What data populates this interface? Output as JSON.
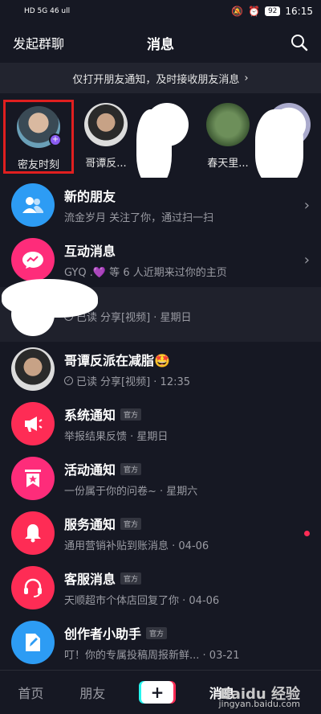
{
  "status_bar": {
    "left_text": "HD 5G 46 ull",
    "battery": "92",
    "time": "16:15"
  },
  "header": {
    "left_action": "发起群聊",
    "title": "消息"
  },
  "notice": {
    "text": "仅打开朋友通知，及时接收朋友消息",
    "arrow": "›"
  },
  "stories": [
    {
      "label": "密友时刻"
    },
    {
      "label": "哥谭反..."
    },
    {
      "label": ""
    },
    {
      "label": "春天里..."
    },
    {
      "label": ""
    }
  ],
  "messages": [
    {
      "name": "新的朋友",
      "sub": "流金岁月 关注了你，通过扫一扫",
      "chevron": "›"
    },
    {
      "name": "互动消息",
      "sub": "GYQ .💜 等 6 人近期来过你的主页",
      "chevron": "›"
    },
    {
      "name": "",
      "status": "已读",
      "sub": "分享[视频] · 星期日"
    },
    {
      "name": "哥谭反派在减脂🤩",
      "status": "已读",
      "sub": "分享[视频] · 12:35"
    },
    {
      "name": "系统通知",
      "badge": "官方",
      "sub": "举报结果反馈 · 星期日"
    },
    {
      "name": "活动通知",
      "badge": "官方",
      "sub": "一份属于你的问卷~ · 星期六"
    },
    {
      "name": "服务通知",
      "badge": "官方",
      "sub": "通用营销补贴到账消息 · 04-06"
    },
    {
      "name": "客服消息",
      "badge": "官方",
      "sub": "天顺超市个体店回复了你 · 04-06"
    },
    {
      "name": "创作者小助手",
      "badge": "官方",
      "sub": "叮！你的专属投稿周报新鲜... · 03-21"
    }
  ],
  "bottom_nav": {
    "home": "首页",
    "friends": "朋友",
    "add": "+",
    "messages": "消息",
    "watermark_line1": "Baidu 经验",
    "watermark_line2": "jingyan.baidu.com"
  },
  "colors": {
    "background": "#161823",
    "accent_red": "#fe2c55",
    "blue": "#2d9cf4",
    "pink": "#fe2c7a",
    "official_badge": "#33353f"
  }
}
